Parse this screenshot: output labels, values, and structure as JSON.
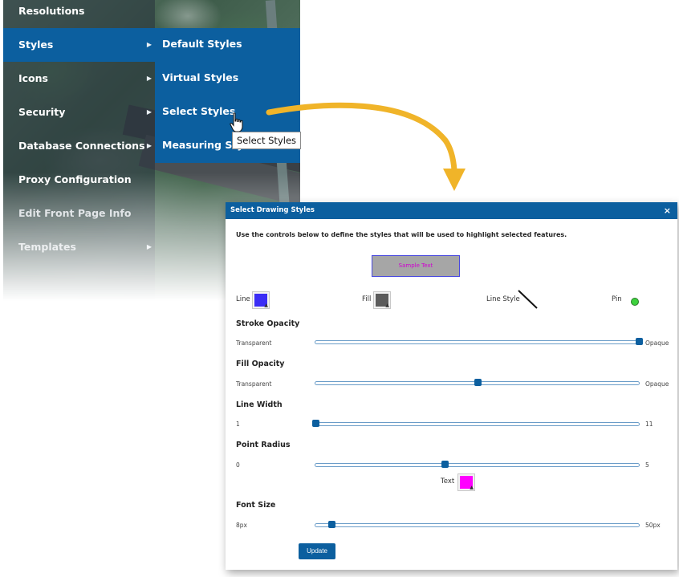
{
  "menu": {
    "items": [
      {
        "label": "Resolutions",
        "has_submenu": false
      },
      {
        "label": "Styles",
        "has_submenu": true,
        "active": true
      },
      {
        "label": "Icons",
        "has_submenu": true
      },
      {
        "label": "Security",
        "has_submenu": true
      },
      {
        "label": "Database Connections",
        "has_submenu": true
      },
      {
        "label": "Proxy Configuration",
        "has_submenu": false
      },
      {
        "label": "Edit Front Page Info",
        "has_submenu": false
      },
      {
        "label": "Templates",
        "has_submenu": true
      }
    ],
    "caret": "▶",
    "active_color": "#0c5f9f"
  },
  "submenu": {
    "items": [
      {
        "label": "Default Styles"
      },
      {
        "label": "Virtual Styles"
      },
      {
        "label": "Select Styles"
      },
      {
        "label": "Measuring Styles"
      }
    ]
  },
  "tooltip": {
    "text": "Select Styles"
  },
  "arrow": {
    "color": "#f0b429"
  },
  "dialog": {
    "title": "Select Drawing Styles",
    "close_glyph": "×",
    "instructions": "Use the controls below to define the styles that will be used to highlight selected features.",
    "sample_text": "Sample Text",
    "line_label": "Line",
    "line_color": "#3b2df5",
    "fill_label": "Fill",
    "fill_color": "#5c5c5c",
    "line_style_label": "Line Style",
    "pin_label": "Pin",
    "pin_color": "#3dd13d",
    "text_label": "Text",
    "text_color": "#ff00ff",
    "dropdown_glyph": "▲",
    "sliders": [
      {
        "title": "Stroke Opacity",
        "min_label": "Transparent",
        "max_label": "Opaque",
        "value_fraction": 1.0
      },
      {
        "title": "Fill Opacity",
        "min_label": "Transparent",
        "max_label": "Opaque",
        "value_fraction": 0.5
      },
      {
        "title": "Line Width",
        "min_label": "1",
        "max_label": "11",
        "value_fraction": 0.0
      },
      {
        "title": "Point Radius",
        "min_label": "0",
        "max_label": "5",
        "value_fraction": 0.4
      },
      {
        "title": "Font Size",
        "min_label": "8px",
        "max_label": "50px",
        "value_fraction": 0.05
      }
    ],
    "update_label": "Update"
  }
}
